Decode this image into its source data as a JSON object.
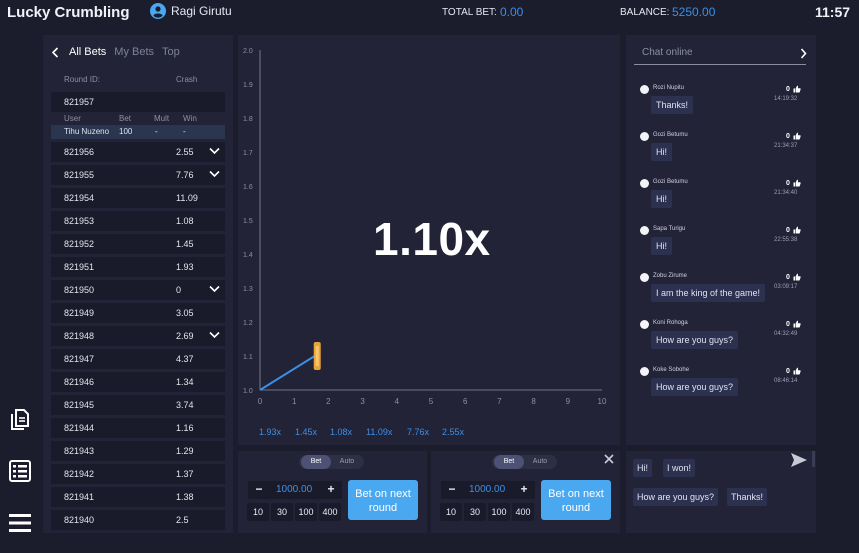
{
  "header": {
    "app_title": "Lucky Crumbling",
    "user_name": "Ragi Girutu",
    "total_bet_label": "TOTAL BET:",
    "total_bet_value": "0.00",
    "balance_label": "BALANCE:",
    "balance_value": "5250.00",
    "clock": "11:57"
  },
  "colors": {
    "accent": "#3b8fe6",
    "button": "#4aa8f0",
    "panel": "#222336",
    "background": "#1b1c2c",
    "rocket": "#e8a43a"
  },
  "left_icons": [
    "document-icon",
    "list-icon",
    "menu-icon"
  ],
  "bets": {
    "tabs": [
      "All Bets",
      "My Bets",
      "Top"
    ],
    "active_tab": "All Bets",
    "col_round": "Round ID:",
    "col_crash": "Crash",
    "expanded": {
      "round": "821957",
      "sub_headers": [
        "User",
        "Bet",
        "Mult",
        "Win"
      ],
      "entry": {
        "user": "Tihu Nuzeno",
        "bet": "100",
        "mult": "-",
        "win": "-"
      }
    },
    "rows": [
      {
        "round": "821956",
        "crash": "2.55",
        "expand": true
      },
      {
        "round": "821955",
        "crash": "7.76",
        "expand": true
      },
      {
        "round": "821954",
        "crash": "11.09",
        "expand": false
      },
      {
        "round": "821953",
        "crash": "1.08",
        "expand": false
      },
      {
        "round": "821952",
        "crash": "1.45",
        "expand": false
      },
      {
        "round": "821951",
        "crash": "1.93",
        "expand": false
      },
      {
        "round": "821950",
        "crash": "0",
        "expand": true
      },
      {
        "round": "821949",
        "crash": "3.05",
        "expand": false
      },
      {
        "round": "821948",
        "crash": "2.69",
        "expand": true
      },
      {
        "round": "821947",
        "crash": "4.37",
        "expand": false
      },
      {
        "round": "821946",
        "crash": "1.34",
        "expand": false
      },
      {
        "round": "821945",
        "crash": "3.74",
        "expand": false
      },
      {
        "round": "821944",
        "crash": "1.16",
        "expand": false
      },
      {
        "round": "821943",
        "crash": "1.29",
        "expand": false
      },
      {
        "round": "821942",
        "crash": "1.37",
        "expand": false
      },
      {
        "round": "821941",
        "crash": "1.38",
        "expand": false
      },
      {
        "round": "821940",
        "crash": "2.5",
        "expand": false
      }
    ]
  },
  "game": {
    "multiplier": "1.10x",
    "history": [
      "1.93x",
      "1.45x",
      "1.08x",
      "11.09x",
      "7.76x",
      "2.55x"
    ]
  },
  "chart_data": {
    "type": "line",
    "x_ticks": [
      "0",
      "1",
      "2",
      "3",
      "4",
      "5",
      "6",
      "7",
      "8",
      "9",
      "10"
    ],
    "y_ticks": [
      "1.0",
      "1.1",
      "1.2",
      "1.3",
      "1.4",
      "1.5",
      "1.6",
      "1.7",
      "1.8",
      "1.9",
      "2.0"
    ],
    "xlim": [
      0,
      10
    ],
    "ylim": [
      1.0,
      2.0
    ],
    "series": [
      {
        "x": [
          0,
          1.6
        ],
        "y": [
          1.0,
          1.1
        ]
      }
    ],
    "grid": false
  },
  "bet_panels": [
    {
      "toggle": [
        "Bet",
        "Auto"
      ],
      "active": "Bet",
      "amount": "1000.00",
      "minus": "−",
      "plus": "+",
      "quick": [
        "10",
        "30",
        "100",
        "400"
      ],
      "button": "Bet on next round",
      "closable": false
    },
    {
      "toggle": [
        "Bet",
        "Auto"
      ],
      "active": "Bet",
      "amount": "1000.00",
      "minus": "−",
      "plus": "+",
      "quick": [
        "10",
        "30",
        "100",
        "400"
      ],
      "button": "Bet on next round",
      "closable": true
    }
  ],
  "chat": {
    "title": "Chat online",
    "messages": [
      {
        "user": "Rozi Nupitu",
        "likes": "0",
        "time": "14:19:32",
        "text": "Thanks!"
      },
      {
        "user": "Gozi Betumu",
        "likes": "0",
        "time": "21:34:37",
        "text": "Hi!"
      },
      {
        "user": "Gozi Betumu",
        "likes": "0",
        "time": "21:34:40",
        "text": "Hi!"
      },
      {
        "user": "Sapa Turigu",
        "likes": "0",
        "time": "22:55:38",
        "text": "Hi!"
      },
      {
        "user": "Zobu Zirume",
        "likes": "0",
        "time": "03:09:17",
        "text": "I am the king of the game!"
      },
      {
        "user": "Koni Rohoga",
        "likes": "0",
        "time": "04:32:49",
        "text": "How are you guys?"
      },
      {
        "user": "Koke Sobohe",
        "likes": "0",
        "time": "08:46:14",
        "text": "How are you guys?"
      }
    ],
    "quick_messages": [
      "Hi!",
      "I won!",
      "How are you guys?",
      "Thanks!"
    ]
  }
}
